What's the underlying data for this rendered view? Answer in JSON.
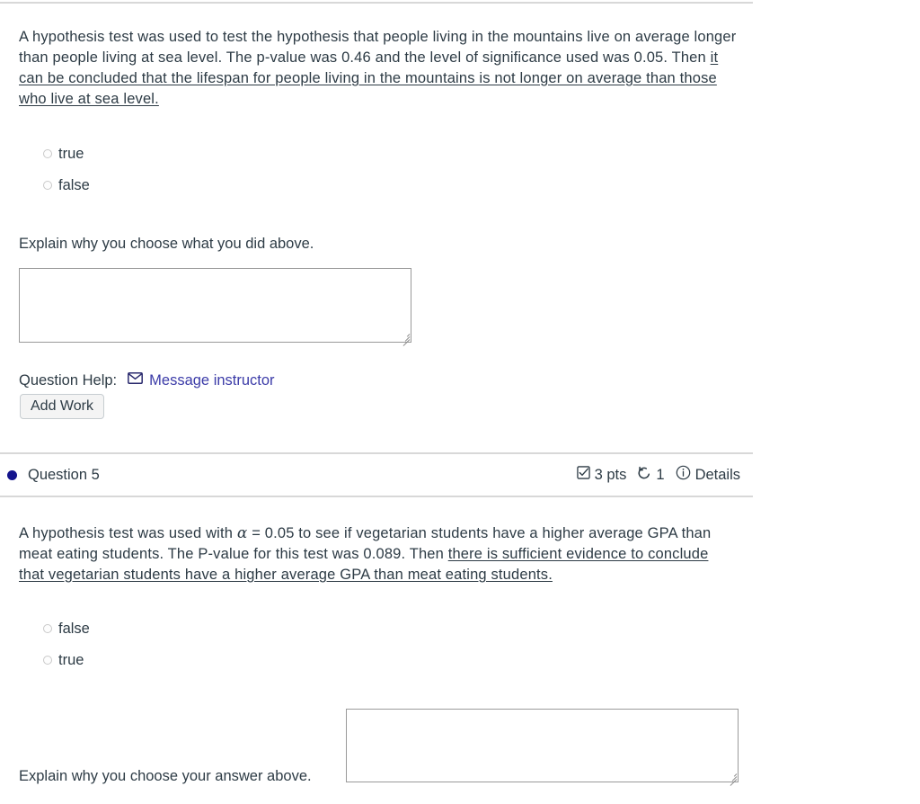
{
  "dividers": {
    "color": "#d8d8d8"
  },
  "question4": {
    "body_prefix": "A hypothesis test was used to test the hypothesis that people living in the mountains live on average longer than people living at sea level. The p-value was 0.46 and the level of significance used was 0.05. Then ",
    "body_underlined": "it can be concluded that the lifespan for people living in the mountains is not longer on average than those who live at sea level.",
    "options": [
      {
        "label": "true",
        "selected": false
      },
      {
        "label": "false",
        "selected": false
      }
    ],
    "explain_label": "Explain why you choose what you did above.",
    "explain_value": "",
    "explain_placeholder": "",
    "help_label": "Question Help:",
    "message_instructor_link": "Message instructor",
    "message_icon": "envelope-icon",
    "add_work_label": "Add Work"
  },
  "question5": {
    "status_dot_color": "#14148c",
    "title": "Question 5",
    "points": "3 pts",
    "points_icon": "checkbox-checked-icon",
    "attempts": "1",
    "attempts_icon": "retry-arrow-icon",
    "details_label": "Details",
    "details_icon": "info-circle-icon",
    "body_part1": "A hypothesis test was used with ",
    "body_alpha": "α",
    "body_part2": " = 0.05 to see if vegetarian students have a higher average GPA than meat eating students. The P-value for this test was 0.089. Then ",
    "body_underlined": "there is sufficient evidence to conclude that vegetarian students have a higher average GPA than meat eating students.",
    "options": [
      {
        "label": "false",
        "selected": false
      },
      {
        "label": "true",
        "selected": false
      }
    ],
    "explain_label": "Explain why you choose your answer above.",
    "explain_value": "",
    "explain_placeholder": ""
  }
}
